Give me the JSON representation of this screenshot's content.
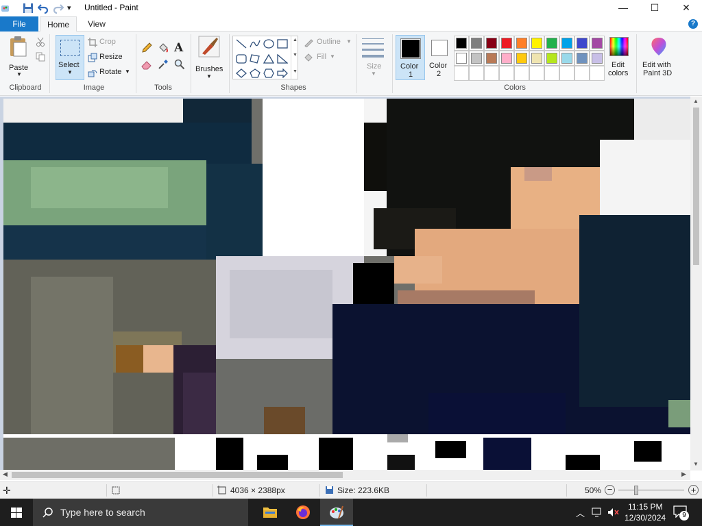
{
  "window": {
    "title": "Untitled - Paint"
  },
  "window_controls": {
    "minimize": "—",
    "maximize": "☐",
    "close": "✕"
  },
  "tabs": {
    "file": "File",
    "home": "Home",
    "view": "View"
  },
  "ribbon": {
    "clipboard": {
      "paste": "Paste",
      "group": "Clipboard"
    },
    "image": {
      "select": "Select",
      "crop": "Crop",
      "resize": "Resize",
      "rotate": "Rotate",
      "group": "Image"
    },
    "tools": {
      "group": "Tools"
    },
    "brushes": {
      "label": "Brushes"
    },
    "shapes": {
      "outline": "Outline",
      "fill": "Fill",
      "group": "Shapes"
    },
    "size": {
      "label": "Size"
    },
    "colors": {
      "color1_label": "Color",
      "color1_num": "1",
      "color2_label": "Color",
      "color2_num": "2",
      "edit_colors_1": "Edit",
      "edit_colors_2": "colors",
      "paint3d_1": "Edit with",
      "paint3d_2": "Paint 3D",
      "group": "Colors",
      "color1_value": "#000000",
      "color2_value": "#ffffff",
      "palette_row1": [
        "#000000",
        "#7f7f7f",
        "#880015",
        "#ed1c24",
        "#ff7f27",
        "#fff200",
        "#22b14c",
        "#00a2e8",
        "#3f48cc",
        "#a349a4"
      ],
      "palette_row2": [
        "#ffffff",
        "#c3c3c3",
        "#b97a57",
        "#ffaec9",
        "#ffc90e",
        "#efe4b0",
        "#b5e61d",
        "#99d9ea",
        "#7092be",
        "#c8bfe7"
      ]
    }
  },
  "statusbar": {
    "dimensions": "4036 × 2388px",
    "size": "Size: 223.6KB",
    "zoom": "50%"
  },
  "taskbar": {
    "search_placeholder": "Type here to search",
    "time": "11:15 PM",
    "date": "12/30/2024",
    "notification_count": "9"
  }
}
